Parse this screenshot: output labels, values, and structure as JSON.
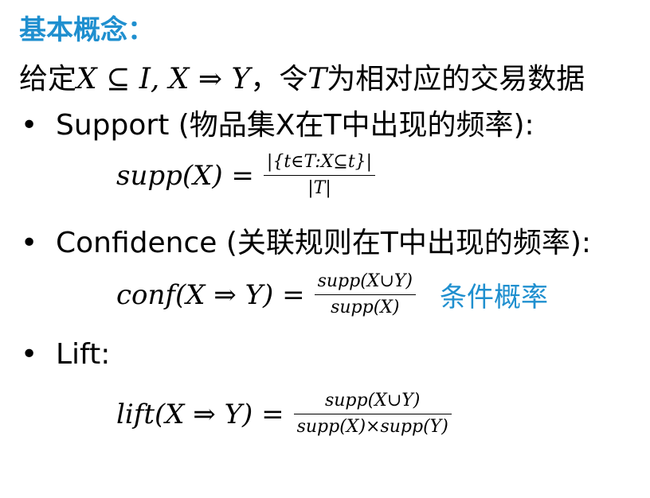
{
  "title": "基本概念：",
  "intro": {
    "prefix": "给定",
    "math": "X ⊆ I, X ⇒ Y",
    "middle": "，令",
    "math2": "T",
    "suffix": "为相对应的交易数据"
  },
  "bullets": [
    {
      "label": "Support (物品集X在T中出现的频率):"
    },
    {
      "label": "Confidence (关联规则在T中出现的频率):"
    },
    {
      "label": "Lift:"
    }
  ],
  "formulas": {
    "support": {
      "lhs": "supp(X) =",
      "num": "|{t∈T:X⊆t}|",
      "den": "|T|"
    },
    "confidence": {
      "lhs": "conf(X ⇒ Y) =",
      "num": "supp(X∪Y)",
      "den": "supp(X)",
      "note": "条件概率"
    },
    "lift": {
      "lhs": "lift(X ⇒ Y) =",
      "num": "supp(X∪Y)",
      "den": "supp(X)×supp(Y)"
    }
  },
  "colors": {
    "accent": "#1f8fcf",
    "text": "#000000"
  }
}
